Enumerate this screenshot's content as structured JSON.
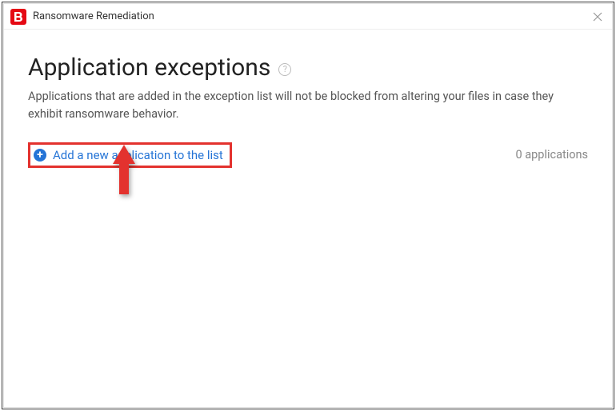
{
  "titlebar": {
    "title": "Ransomware Remediation"
  },
  "page": {
    "title": "Application exceptions",
    "description": "Applications that are added in the exception list will not be blocked from altering your files in case they exhibit ransomware behavior.",
    "add_label": "Add a new application to the list",
    "count_text": "0 applications"
  }
}
